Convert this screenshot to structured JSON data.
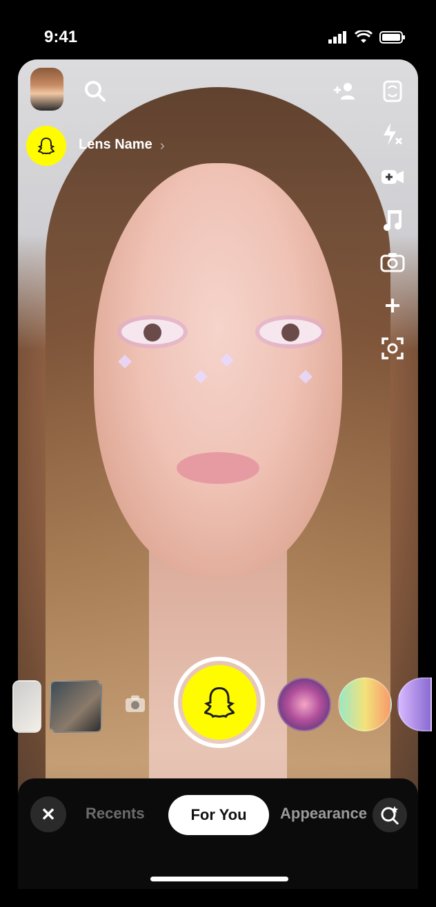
{
  "status_bar": {
    "time": "9:41"
  },
  "header": {
    "lens_name": "Lens Name",
    "lens_chevron": "›"
  },
  "icons": {
    "search": "search-icon",
    "add_friend": "add-friend-icon",
    "flip_camera": "flip-camera-icon",
    "flash_off": "flash-off-icon",
    "video_call": "video-icon",
    "music": "music-note-icon",
    "screenshot": "camera-roll-icon",
    "more": "plus-icon",
    "scan": "scan-icon"
  },
  "carousel": {
    "lenses": [
      {
        "name": "lens-thumbnail-1"
      },
      {
        "name": "lens-thumbnail-2"
      },
      {
        "name": "lens-brain"
      },
      {
        "name": "lens-nerd-glasses"
      },
      {
        "name": "lens-purple"
      }
    ]
  },
  "bottom_bar": {
    "tabs": [
      {
        "label": "Recents"
      },
      {
        "label": "For You"
      },
      {
        "label": "Appearance"
      }
    ],
    "close_label": "✕"
  },
  "colors": {
    "snap_yellow": "#fffc00",
    "background": "#000000",
    "bar_bg": "#0b0b0b"
  }
}
